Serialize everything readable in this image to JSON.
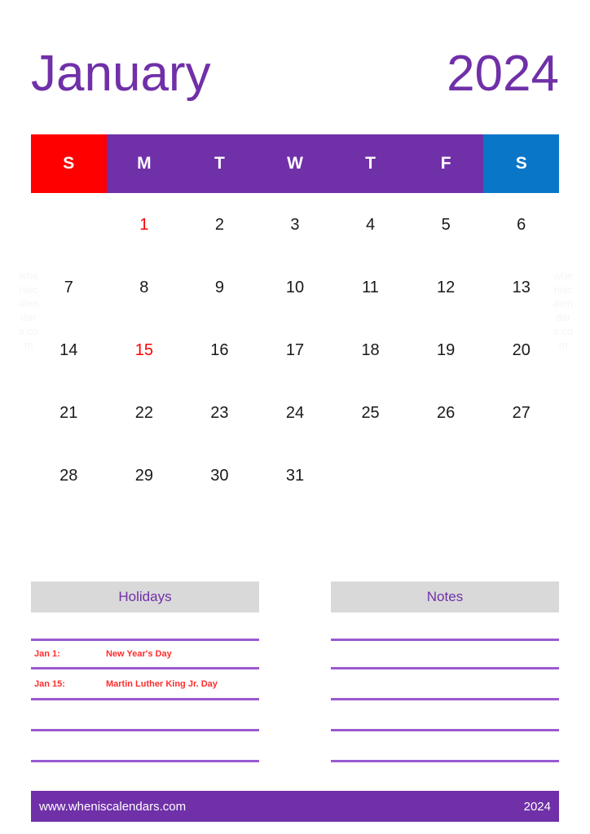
{
  "title": {
    "month": "January",
    "year": "2024"
  },
  "watermark": {
    "text": "wheniscalendars.com"
  },
  "weekdays": [
    {
      "label": "S",
      "kind": "sunday"
    },
    {
      "label": "M",
      "kind": "weekday"
    },
    {
      "label": "T",
      "kind": "weekday"
    },
    {
      "label": "W",
      "kind": "weekday"
    },
    {
      "label": "T",
      "kind": "weekday"
    },
    {
      "label": "F",
      "kind": "weekday"
    },
    {
      "label": "S",
      "kind": "saturday"
    }
  ],
  "days": [
    {
      "n": "",
      "kind": "empty"
    },
    {
      "n": "1",
      "kind": "holiday"
    },
    {
      "n": "2",
      "kind": "weekday"
    },
    {
      "n": "3",
      "kind": "weekday"
    },
    {
      "n": "4",
      "kind": "weekday"
    },
    {
      "n": "5",
      "kind": "weekday"
    },
    {
      "n": "6",
      "kind": "saturday"
    },
    {
      "n": "7",
      "kind": "sunday"
    },
    {
      "n": "8",
      "kind": "weekday"
    },
    {
      "n": "9",
      "kind": "weekday"
    },
    {
      "n": "10",
      "kind": "weekday"
    },
    {
      "n": "11",
      "kind": "weekday"
    },
    {
      "n": "12",
      "kind": "weekday"
    },
    {
      "n": "13",
      "kind": "saturday"
    },
    {
      "n": "14",
      "kind": "sunday"
    },
    {
      "n": "15",
      "kind": "holiday"
    },
    {
      "n": "16",
      "kind": "weekday"
    },
    {
      "n": "17",
      "kind": "weekday"
    },
    {
      "n": "18",
      "kind": "weekday"
    },
    {
      "n": "19",
      "kind": "weekday"
    },
    {
      "n": "20",
      "kind": "saturday"
    },
    {
      "n": "21",
      "kind": "sunday"
    },
    {
      "n": "22",
      "kind": "weekday"
    },
    {
      "n": "23",
      "kind": "weekday"
    },
    {
      "n": "24",
      "kind": "weekday"
    },
    {
      "n": "25",
      "kind": "weekday"
    },
    {
      "n": "26",
      "kind": "weekday"
    },
    {
      "n": "27",
      "kind": "saturday"
    },
    {
      "n": "28",
      "kind": "sunday"
    },
    {
      "n": "29",
      "kind": "weekday"
    },
    {
      "n": "30",
      "kind": "weekday"
    },
    {
      "n": "31",
      "kind": "weekday"
    },
    {
      "n": "",
      "kind": "empty"
    },
    {
      "n": "",
      "kind": "empty"
    },
    {
      "n": "",
      "kind": "empty"
    }
  ],
  "holidays_panel": {
    "heading": "Holidays",
    "entries": [
      {
        "date": "Jan 1:",
        "name": "New Year's Day"
      },
      {
        "date": "Jan 15:",
        "name": "Martin Luther King Jr. Day"
      },
      {
        "date": "",
        "name": ""
      },
      {
        "date": "",
        "name": ""
      },
      {
        "date": "",
        "name": ""
      }
    ]
  },
  "notes_panel": {
    "heading": "Notes",
    "entries": [
      {
        "date": "",
        "name": ""
      },
      {
        "date": "",
        "name": ""
      },
      {
        "date": "",
        "name": ""
      },
      {
        "date": "",
        "name": ""
      },
      {
        "date": "",
        "name": ""
      }
    ]
  },
  "footer": {
    "site": "www.wheniscalendars.com",
    "year": "2024"
  },
  "colors": {
    "purple": "#7030a8",
    "red": "#ff0000",
    "blue": "#0a76c8",
    "saturday_text": "#1a7ad4",
    "panel_head_bg": "#d9d9d9",
    "rule": "#9b59d0",
    "watermark": "#f5f5f5"
  }
}
